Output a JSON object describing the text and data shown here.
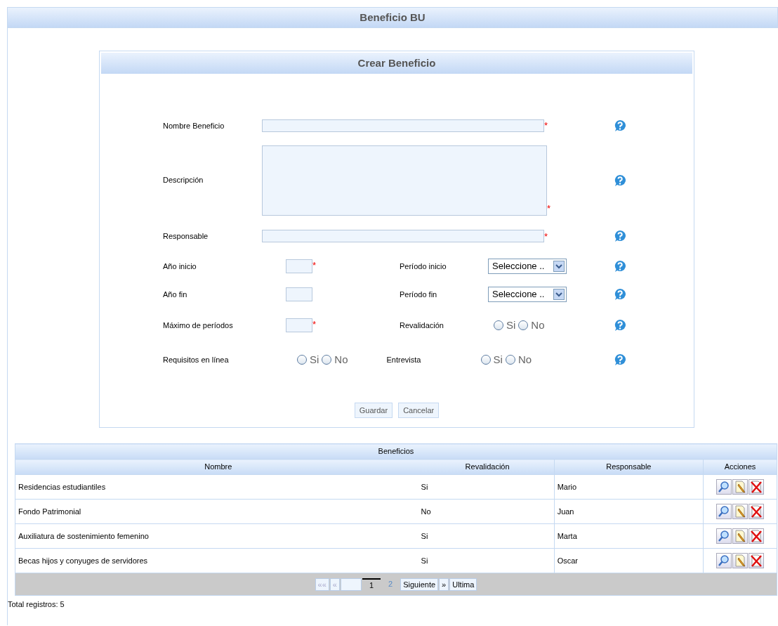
{
  "page_title": "Beneficio BU",
  "form": {
    "title": "Crear Beneficio",
    "rows": [
      {
        "fields": [
          {
            "kind": "text",
            "label": "Nombre Beneficio",
            "required_mark": "*"
          }
        ]
      },
      {
        "fields": [
          {
            "kind": "textarea",
            "label": "Descripción",
            "required_mark": "*"
          }
        ]
      },
      {
        "fields": [
          {
            "kind": "text",
            "label": "Responsable",
            "required_mark": "*"
          }
        ]
      },
      {
        "fields": [
          {
            "kind": "short",
            "label": "Año inicio",
            "required_mark": "*"
          },
          {
            "kind": "select",
            "label": "Período inicio",
            "value": "Seleccione .."
          }
        ]
      },
      {
        "fields": [
          {
            "kind": "short",
            "label": "Año fin"
          },
          {
            "kind": "select",
            "label": "Período fin",
            "value": "Seleccione .."
          }
        ]
      },
      {
        "fields": [
          {
            "kind": "short",
            "label": "Máximo de períodos",
            "required_mark": "*"
          },
          {
            "kind": "radio",
            "label": "Revalidación",
            "options": [
              {
                "label": "Si",
                "selected": false
              },
              {
                "label": "No",
                "selected": false
              }
            ]
          }
        ]
      },
      {
        "fields": [
          {
            "kind": "radio",
            "label": "Requisitos en línea",
            "options": [
              {
                "label": "Si",
                "selected": false
              },
              {
                "label": "No",
                "selected": false
              }
            ]
          },
          {
            "kind": "radio",
            "label": "Entrevista",
            "options": [
              {
                "label": "Si",
                "selected": false
              },
              {
                "label": "No",
                "selected": false
              }
            ]
          }
        ]
      }
    ],
    "buttons": [
      "Guardar",
      "Cancelar"
    ]
  },
  "table": {
    "title": "Beneficios",
    "columns": [
      "Nombre",
      "Revalidación",
      "Responsable",
      "Acciones"
    ],
    "rows": [
      [
        "Residencias estudiantiles",
        "Si",
        "Mario"
      ],
      [
        "Fondo Patrimonial",
        "No",
        "Juan"
      ],
      [
        "Auxiliatura de sostenimiento femenino",
        "Si",
        "Marta"
      ],
      [
        "Becas hijos y conyuges de servidores",
        "Si",
        "Oscar"
      ]
    ],
    "pagination": [
      {
        "kind": "button",
        "label": "««",
        "disabled": true
      },
      {
        "kind": "button",
        "label": "«",
        "disabled": true
      },
      {
        "kind": "blank"
      },
      {
        "kind": "page",
        "label": "1",
        "selected": true
      },
      {
        "kind": "page",
        "label": "2",
        "selected": false
      },
      {
        "kind": "button",
        "label": "Siguiente",
        "disabled": false
      },
      {
        "kind": "button",
        "label": "»",
        "disabled": false
      },
      {
        "kind": "button",
        "label": "Ultima",
        "disabled": false
      }
    ]
  },
  "total": "Total registros: 5"
}
